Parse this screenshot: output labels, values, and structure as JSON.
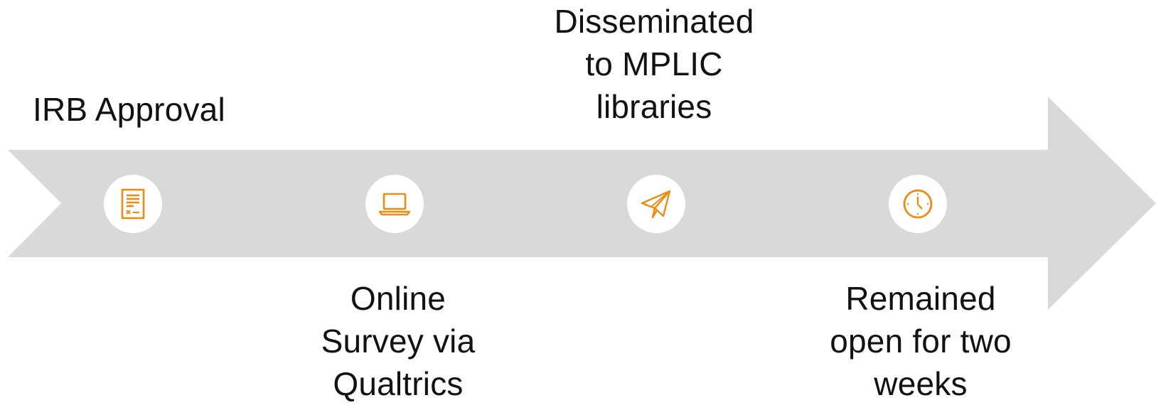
{
  "colors": {
    "arrow": "#d9d9d9",
    "accent": "#f08a12",
    "icon_bg": "#ffffff",
    "text": "#111111"
  },
  "steps": [
    {
      "label": "IRB Approval",
      "icon": "document-icon"
    },
    {
      "label": "Online\nSurvey via\nQualtrics",
      "icon": "laptop-icon"
    },
    {
      "label": "Disseminated\nto MPLIC\nlibraries",
      "icon": "paper-plane-icon"
    },
    {
      "label": "Remained\nopen for two\nweeks",
      "icon": "clock-icon"
    }
  ]
}
